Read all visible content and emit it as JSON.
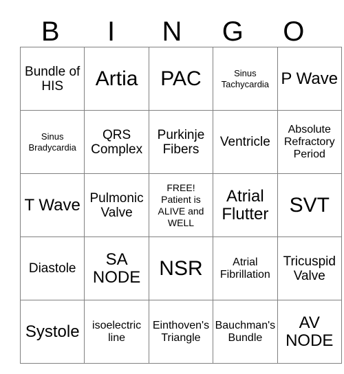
{
  "card": {
    "title": "BINGO",
    "header_letters": [
      "B",
      "I",
      "N",
      "G",
      "O"
    ],
    "rows": [
      [
        {
          "text": "Bundle of HIS",
          "size": "sz-md"
        },
        {
          "text": "Artia",
          "size": "sz-xl"
        },
        {
          "text": "PAC",
          "size": "sz-xl"
        },
        {
          "text": "Sinus Tachycardia",
          "size": "sz-xs"
        },
        {
          "text": "P Wave",
          "size": "sz-lg"
        }
      ],
      [
        {
          "text": "Sinus Bradycardia",
          "size": "sz-xs"
        },
        {
          "text": "QRS Complex",
          "size": "sz-md"
        },
        {
          "text": "Purkinje Fibers",
          "size": "sz-md"
        },
        {
          "text": "Ventricle",
          "size": "sz-md"
        },
        {
          "text": "Absolute Refractory Period",
          "size": "sz-sm"
        }
      ],
      [
        {
          "text": "T Wave",
          "size": "sz-lg"
        },
        {
          "text": "Pulmonic Valve",
          "size": "sz-md"
        },
        {
          "text": "FREE! Patient is ALIVE and WELL",
          "size": "sz-free"
        },
        {
          "text": "Atrial Flutter",
          "size": "sz-lg"
        },
        {
          "text": "SVT",
          "size": "sz-xl"
        }
      ],
      [
        {
          "text": "Diastole",
          "size": "sz-md"
        },
        {
          "text": "SA NODE",
          "size": "sz-lg"
        },
        {
          "text": "NSR",
          "size": "sz-xl"
        },
        {
          "text": "Atrial Fibrillation",
          "size": "sz-sm"
        },
        {
          "text": "Tricuspid Valve",
          "size": "sz-md"
        }
      ],
      [
        {
          "text": "Systole",
          "size": "sz-lg"
        },
        {
          "text": "isoelectric line",
          "size": "sz-sm"
        },
        {
          "text": "Einthoven's Triangle",
          "size": "sz-sm"
        },
        {
          "text": "Bauchman's Bundle",
          "size": "sz-sm"
        },
        {
          "text": "AV NODE",
          "size": "sz-lg"
        }
      ]
    ],
    "colors": {
      "background": "#ffffff",
      "text": "#000000",
      "grid_line": "#808080"
    }
  }
}
